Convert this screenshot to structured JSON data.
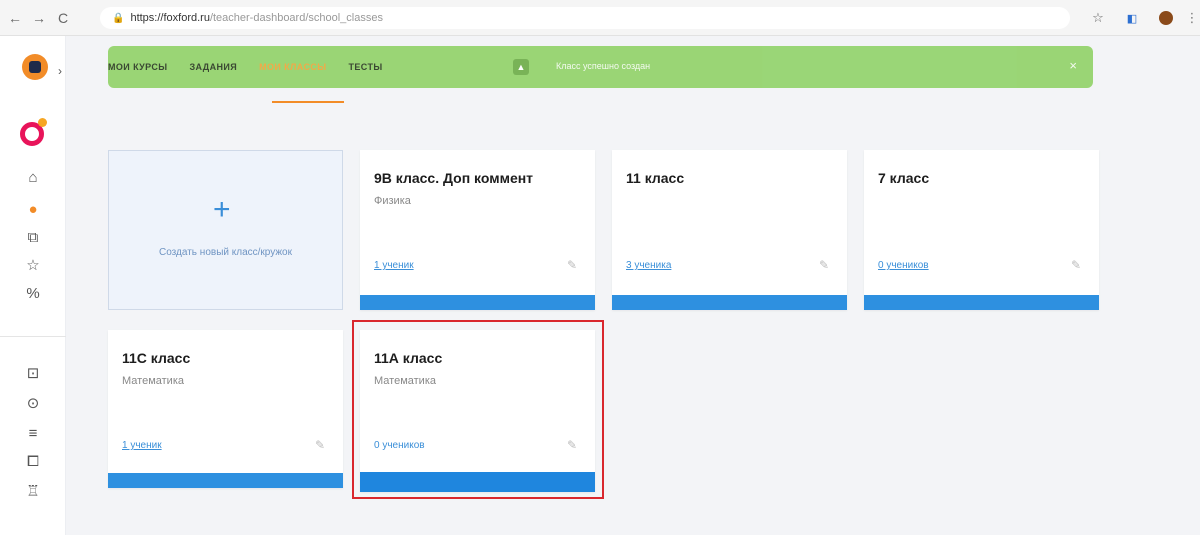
{
  "browser": {
    "url_host": "https://foxford.ru",
    "url_path": "/teacher-dashboard/school_classes",
    "back_glyph": "←",
    "forward_glyph": "→",
    "reload_glyph": "C",
    "star_glyph": "☆",
    "menu_glyph": "⋮"
  },
  "topnav": {
    "items": [
      "МОИ КУРСЫ",
      "ЗАДАНИЯ",
      "МОИ КЛАССЫ",
      "ТЕСТЫ"
    ],
    "active_index": 2
  },
  "banner": {
    "text": "Класс успешно создан",
    "close_glyph": "×",
    "color": "#93d36b"
  },
  "new_class_card": {
    "plus": "+",
    "label": "Создать новый класс/кружок"
  },
  "classes": [
    {
      "title": "9В класс. Доп коммент",
      "subject": "Физика",
      "count": "1 ученик"
    },
    {
      "title": "11 класс",
      "subject": "",
      "count": "3 ученика"
    },
    {
      "title": "7 класс",
      "subject": "",
      "count": "0 учеников"
    },
    {
      "title": "11С класс",
      "subject": "Математика",
      "count": "1 ученик"
    },
    {
      "title": "11А класс",
      "subject": "Математика",
      "count": "0 учеников"
    }
  ],
  "edit_glyph": "✎",
  "accent_color": "#2e90e0",
  "highlight_color": "#d9272e"
}
